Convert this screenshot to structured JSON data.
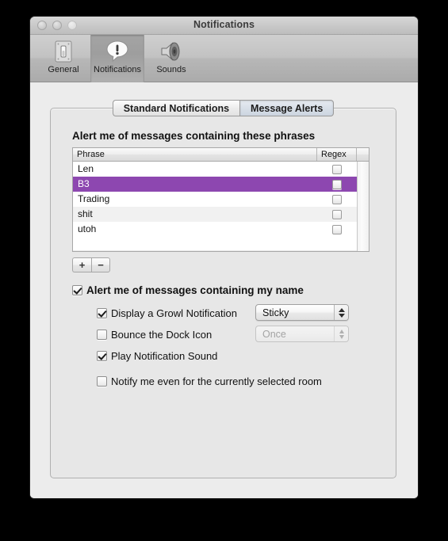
{
  "window": {
    "title": "Notifications",
    "traffic_lights": [
      "close",
      "minimize",
      "zoom"
    ]
  },
  "toolbar": {
    "items": [
      {
        "label": "General",
        "icon": "light-switch-icon",
        "selected": false
      },
      {
        "label": "Notifications",
        "icon": "speech-bubble-exclamation-icon",
        "selected": true
      },
      {
        "label": "Sounds",
        "icon": "speaker-icon",
        "selected": false
      }
    ]
  },
  "tabs": [
    {
      "label": "Standard Notifications",
      "selected": false
    },
    {
      "label": "Message Alerts",
      "selected": true
    }
  ],
  "panel": {
    "phrases_heading": "Alert me of messages containing these phrases",
    "table": {
      "columns": [
        "Phrase",
        "Regex"
      ],
      "selection_color": "#8d47b0",
      "rows": [
        {
          "phrase": "Len",
          "regex": false,
          "selected": false
        },
        {
          "phrase": "B3",
          "regex": false,
          "selected": true
        },
        {
          "phrase": "Trading",
          "regex": false,
          "selected": false
        },
        {
          "phrase": "shit",
          "regex": false,
          "selected": false
        },
        {
          "phrase": "utoh",
          "regex": false,
          "selected": false
        }
      ]
    },
    "add_button": "+",
    "remove_button": "−",
    "options": {
      "my_name": {
        "label": "Alert me of messages containing my name",
        "checked": true
      },
      "growl": {
        "label": "Display a Growl Notification",
        "checked": true
      },
      "bounce": {
        "label": "Bounce the Dock Icon",
        "checked": false
      },
      "sound": {
        "label": "Play Notification Sound",
        "checked": true
      },
      "selected_room": {
        "label": "Notify me even for the currently selected room",
        "checked": false
      }
    },
    "popups": {
      "growl_style": {
        "value": "Sticky",
        "enabled": true
      },
      "bounce_count": {
        "value": "Once",
        "enabled": false
      }
    }
  }
}
